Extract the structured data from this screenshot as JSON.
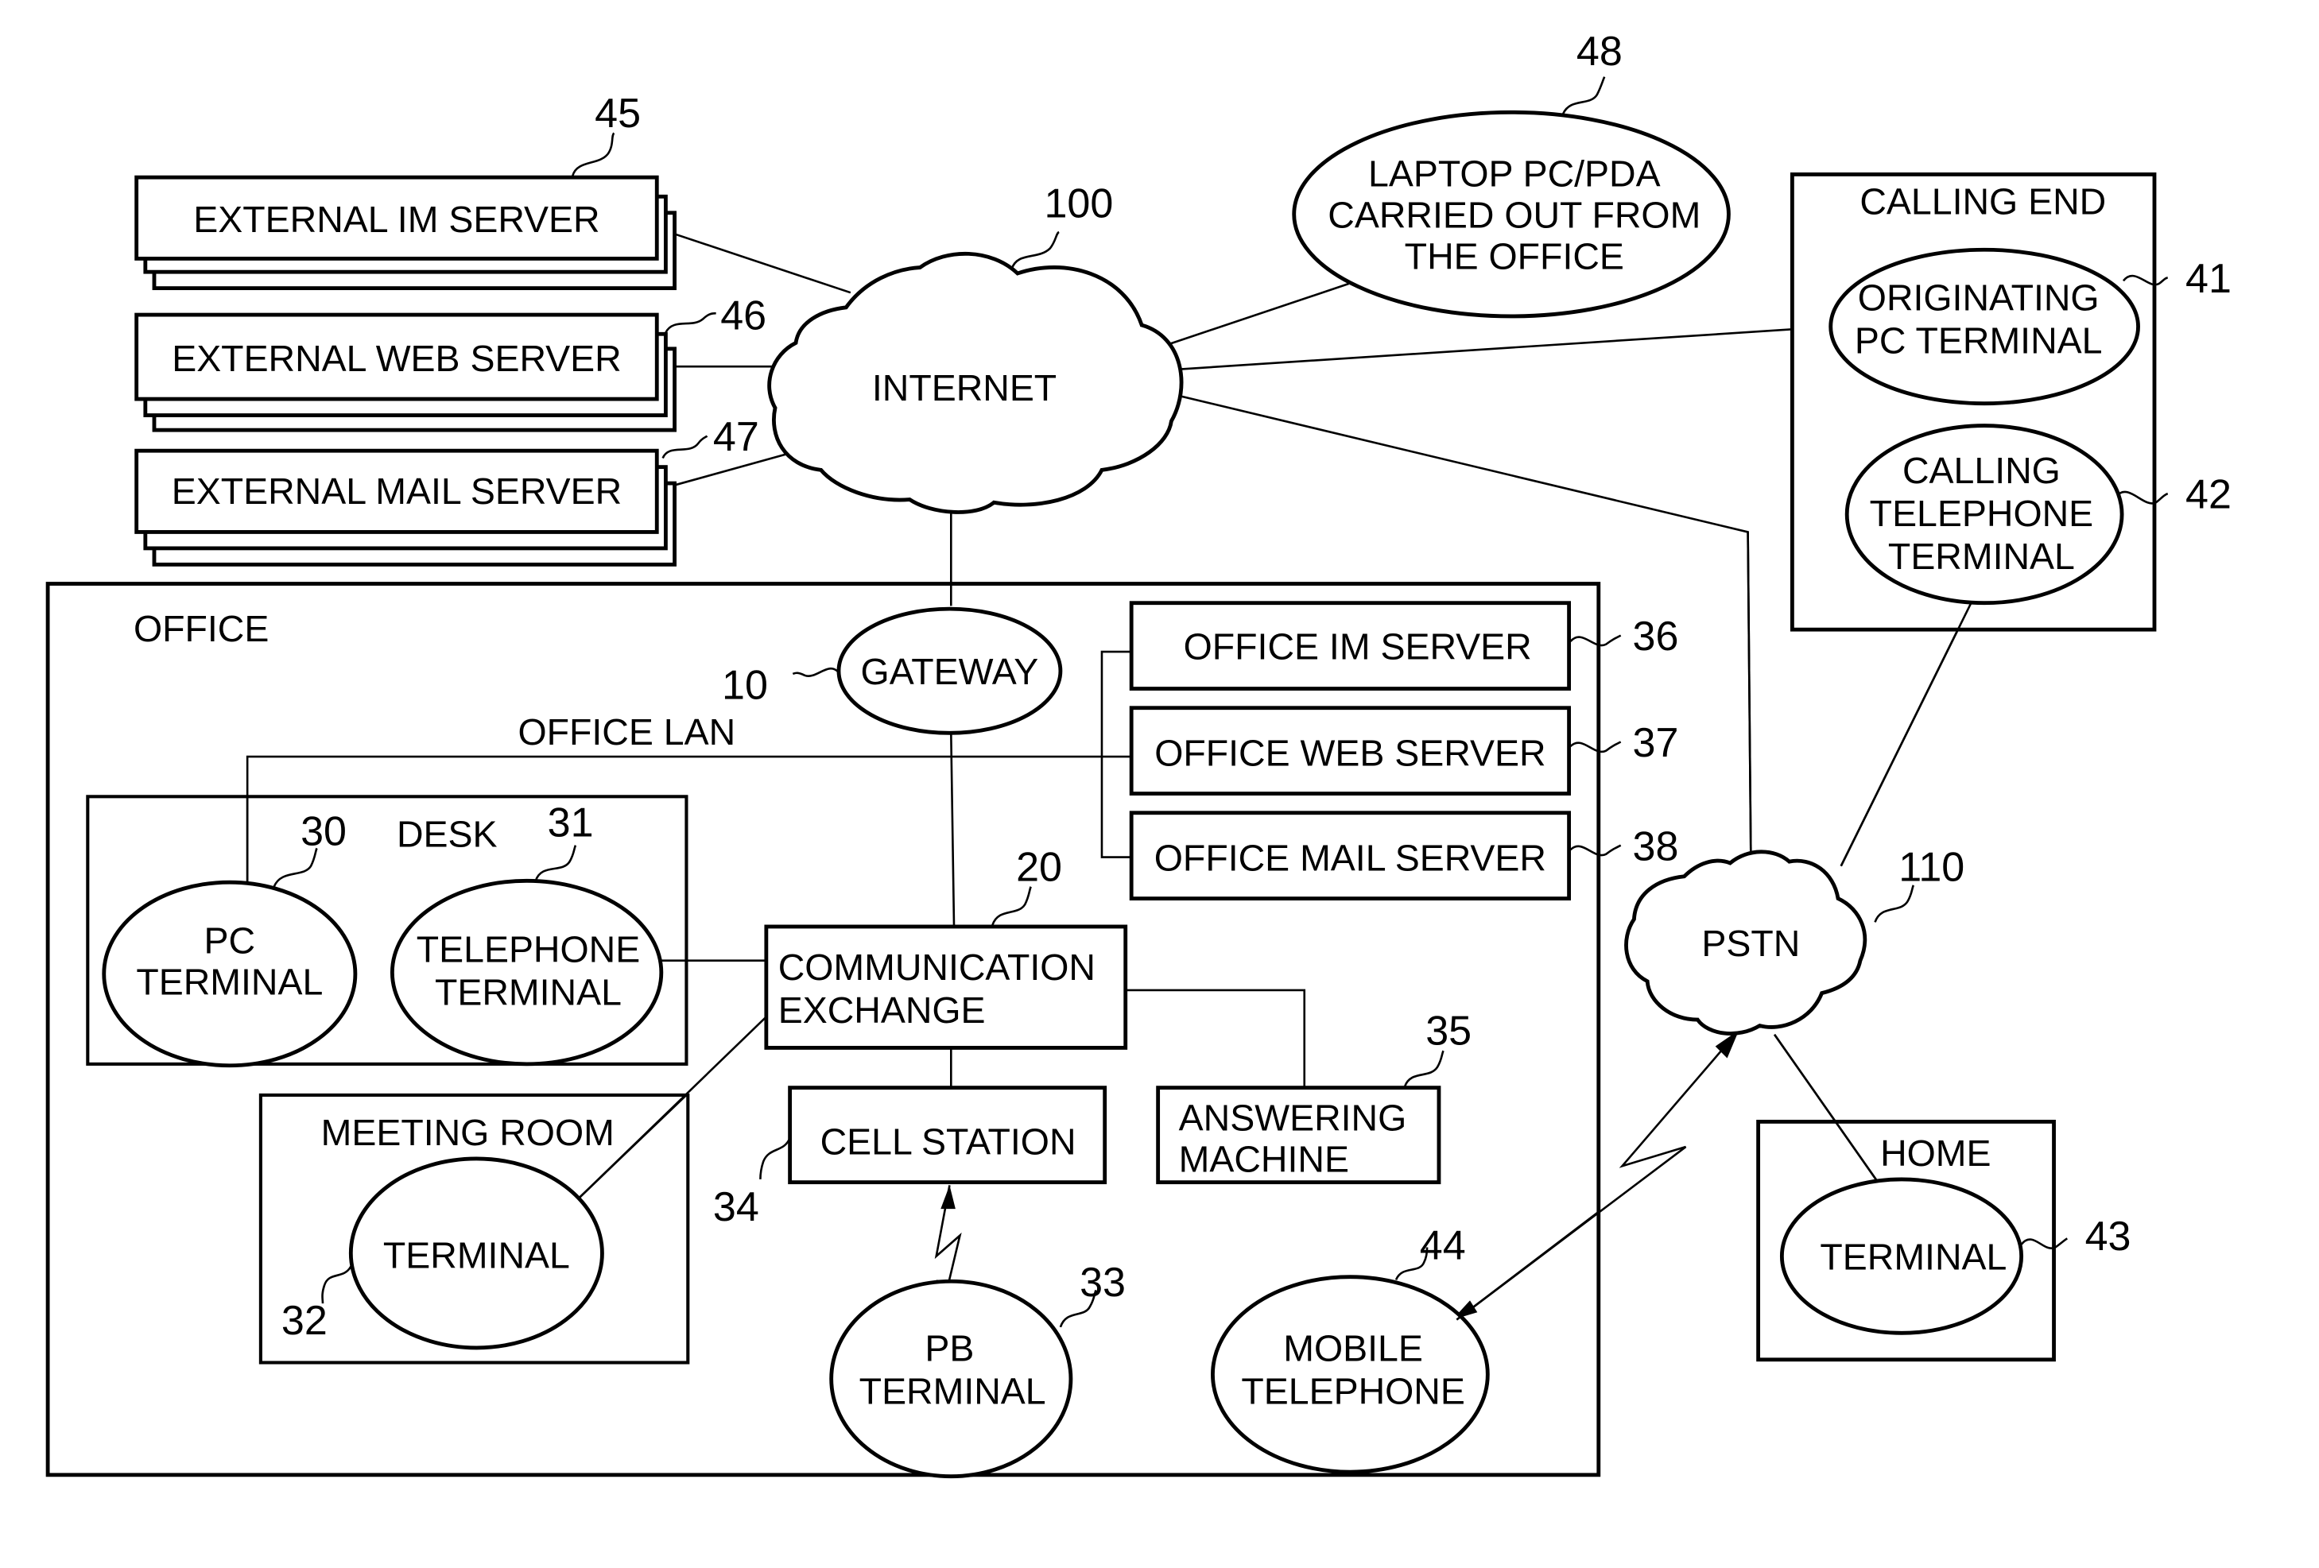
{
  "figure": {
    "network_nodes": {
      "internet": {
        "label": "INTERNET",
        "ref": "100"
      },
      "pstn": {
        "label": "PSTN",
        "ref": "110"
      }
    },
    "external_servers": [
      {
        "label": "EXTERNAL IM SERVER",
        "ref": "45"
      },
      {
        "label": "EXTERNAL WEB SERVER",
        "ref": "46"
      },
      {
        "label": "EXTERNAL MAIL SERVER",
        "ref": "47"
      }
    ],
    "laptop": {
      "lines": [
        "LAPTOP PC/PDA",
        "CARRIED OUT FROM",
        "THE OFFICE"
      ],
      "ref": "48"
    },
    "calling_end": {
      "title": "CALLING END",
      "originating_pc": {
        "lines": [
          "ORIGINATING",
          "PC TERMINAL"
        ],
        "ref": "41"
      },
      "calling_telephone": {
        "lines": [
          "CALLING",
          "TELEPHONE",
          "TERMINAL"
        ],
        "ref": "42"
      }
    },
    "office": {
      "title": "OFFICE",
      "lan_label": "OFFICE LAN",
      "gateway": {
        "label": "GATEWAY",
        "ref": "10"
      },
      "office_servers": [
        {
          "label": "OFFICE IM SERVER",
          "ref": "36"
        },
        {
          "label": "OFFICE WEB SERVER",
          "ref": "37"
        },
        {
          "label": "OFFICE MAIL SERVER",
          "ref": "38"
        }
      ],
      "desk": {
        "title": "DESK",
        "pc_terminal": {
          "lines": [
            "PC",
            "TERMINAL"
          ],
          "ref": "30"
        },
        "telephone_terminal": {
          "lines": [
            "TELEPHONE",
            "TERMINAL"
          ],
          "ref": "31"
        }
      },
      "exchange": {
        "lines": [
          "COMMUNICATION",
          "EXCHANGE"
        ],
        "ref": "20"
      },
      "meeting_room": {
        "title": "MEETING ROOM",
        "terminal": {
          "label": "TERMINAL",
          "ref": "32"
        }
      },
      "cell_station": {
        "label": "CELL STATION",
        "ref": "34"
      },
      "answering_machine": {
        "lines": [
          "ANSWERING",
          "MACHINE"
        ],
        "ref": "35"
      },
      "pb_terminal": {
        "lines": [
          "PB",
          "TERMINAL"
        ],
        "ref": "33"
      },
      "mobile_telephone": {
        "lines": [
          "MOBILE",
          "TELEPHONE"
        ],
        "ref": "44"
      }
    },
    "home": {
      "title": "HOME",
      "terminal": {
        "label": "TERMINAL",
        "ref": "43"
      }
    }
  }
}
